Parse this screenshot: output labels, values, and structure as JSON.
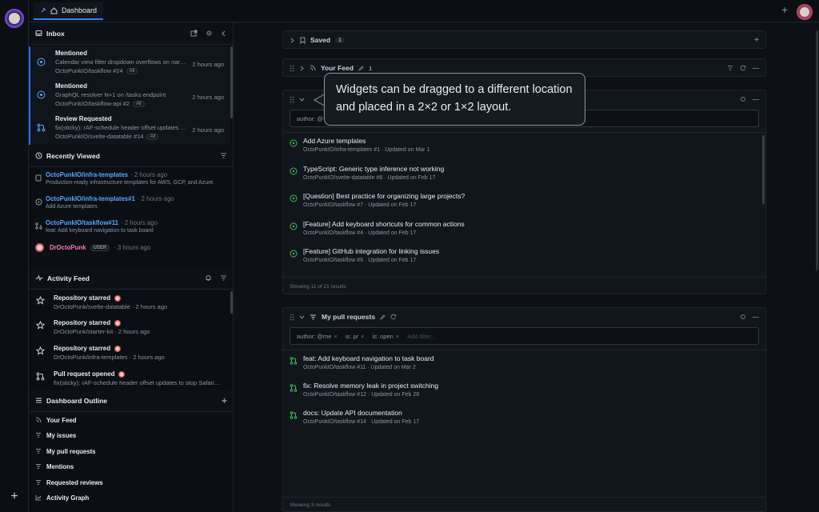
{
  "topbar": {
    "tab_label": "Dashboard"
  },
  "inbox": {
    "title": "Inbox",
    "items": [
      {
        "type": "Mentioned",
        "desc": "Calendar view filter dropdown overflows on nar…",
        "repo": "OctoPunkIO/taskflow #24",
        "badge": "All",
        "time": "2 hours ago"
      },
      {
        "type": "Mentioned",
        "desc": "GraphQL resolver N+1 on /tasks endpoint",
        "repo": "OctoPunkIO/taskflow-api #2",
        "badge": "All",
        "time": "2 hours ago"
      },
      {
        "type": "Review Requested",
        "desc": "fix(sticky): rAF-schedule header offset updates …",
        "repo": "OctoPunkIO/svelte-datatable #14",
        "badge": "All",
        "time": "2 hours ago"
      }
    ]
  },
  "recently_viewed": {
    "title": "Recently Viewed",
    "items": [
      {
        "title": "OctoPunkIO/infra-templates",
        "ago": "· 2 hours ago",
        "desc": "Production-ready infrastructure templates for AWS, GCP, and Azure."
      },
      {
        "title": "OctoPunkIO/infra-templates#1",
        "ago": "· 2 hours ago",
        "desc": "Add Azure templates"
      },
      {
        "title": "OctoPunkIO/taskflow#11",
        "ago": "· 2 hours ago",
        "desc": "feat: Add keyboard navigation to task board"
      },
      {
        "title": "DrOctoPunk",
        "badge": "USER",
        "ago": "· 3 hours ago"
      }
    ]
  },
  "activity_feed": {
    "title": "Activity Feed",
    "items": [
      {
        "title": "Repository starred",
        "desc": "DrOctoPunk/svelte-datatable · 2 hours ago"
      },
      {
        "title": "Repository starred",
        "desc": "DrOctoPunk/starter-kit · 2 hours ago"
      },
      {
        "title": "Repository starred",
        "desc": "DrOctoPunk/infra-templates · 2 hours ago"
      },
      {
        "title": "Pull request opened",
        "desc": "fix(sticky): rAF-schedule header offset updates to stop Safari…"
      }
    ]
  },
  "outline": {
    "title": "Dashboard Outline",
    "items": [
      "Your Feed",
      "My issues",
      "My pull requests",
      "Mentions",
      "Requested reviews",
      "Activity Graph"
    ]
  },
  "saved": {
    "title": "Saved",
    "count": "1"
  },
  "your_feed": {
    "title": "Your Feed",
    "count": "1"
  },
  "issues_widget": {
    "filter_chip": "author: @",
    "items": [
      {
        "title": "Add Azure templates",
        "meta": "OctoPunkIO/infra-templates  #1  ·  Updated on Mar 1"
      },
      {
        "title": "TypeScript: Generic type inference not working",
        "meta": "OctoPunkIO/svelte-datatable  #8  ·  Updated on Feb 17"
      },
      {
        "title": "[Question] Best practice for organizing large projects?",
        "meta": "OctoPunkIO/taskflow  #7  ·  Updated on Feb 17"
      },
      {
        "title": "[Feature] Add keyboard shortcuts for common actions",
        "meta": "OctoPunkIO/taskflow  #4  ·  Updated on Feb 17"
      },
      {
        "title": "[Feature] GitHub integration for linking issues",
        "meta": "OctoPunkIO/taskflow  #6  ·  Updated on Feb 17"
      }
    ],
    "footer": "Showing 11 of 21 results"
  },
  "pr_widget": {
    "title": "My pull requests",
    "chips": [
      {
        "label": "author: @me"
      },
      {
        "label": "is: pr"
      },
      {
        "label": "is: open"
      }
    ],
    "add_filter": "Add filter...",
    "items": [
      {
        "title": "feat: Add keyboard navigation to task board",
        "meta": "OctoPunkIO/taskflow  #11  ·  Updated on Mar 2"
      },
      {
        "title": "fix: Resolve memory leak in project switching",
        "meta": "OctoPunkIO/taskflow  #12  ·  Updated on Feb 28"
      },
      {
        "title": "docs: Update API documentation",
        "meta": "OctoPunkIO/taskflow  #14  ·  Updated on Feb 17"
      }
    ],
    "footer": "Showing 3 results"
  },
  "tooltip": {
    "text": "Widgets can be dragged to a different location and placed in a 2×2 or 1×2 layout."
  },
  "colors": {
    "accent": "#2f81f7",
    "open_green": "#3fb950",
    "link": "#58a6ff"
  }
}
